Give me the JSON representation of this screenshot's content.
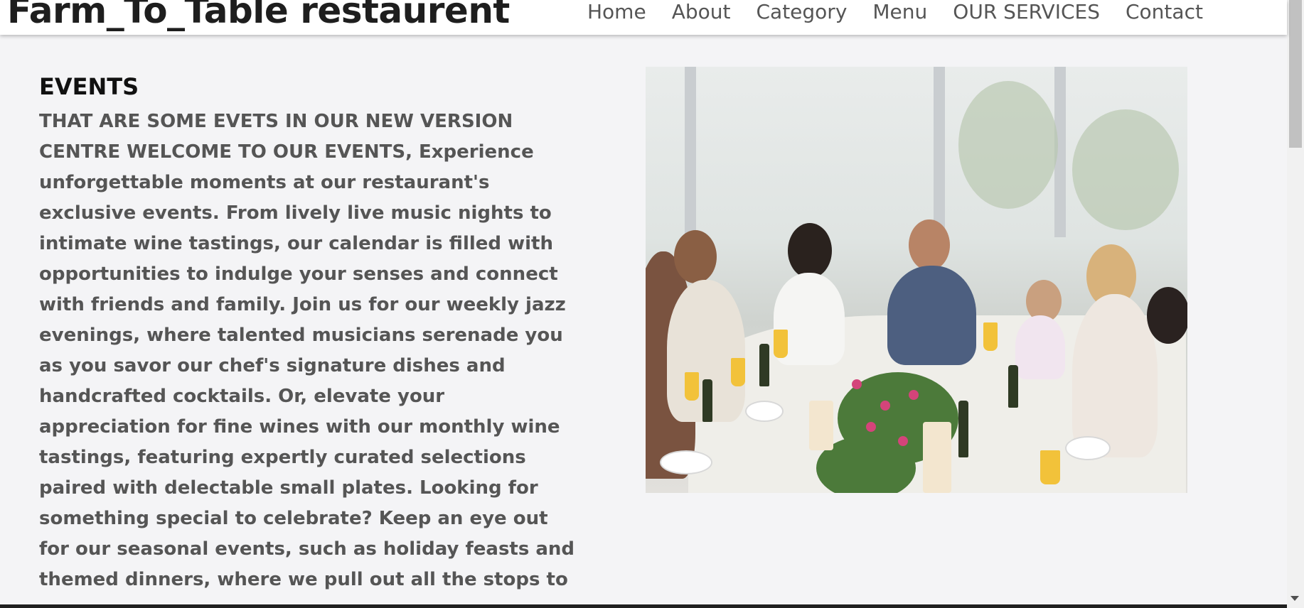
{
  "navbar": {
    "brand": "Farm_To_Table restaurent",
    "links": [
      "Home",
      "About",
      "Category",
      "Menu",
      "OUR SERVICES",
      "Contact"
    ]
  },
  "events": {
    "heading": "EVENTS",
    "text": "THAT ARE SOME EVETS IN OUR NEW VERSION CENTRE WELCOME TO OUR EVENTS, Experience unforgettable moments at our restaurant's exclusive events. From lively live music nights to intimate wine tastings, our calendar is filled with opportunities to indulge your senses and connect with friends and family. Join us for our weekly jazz evenings, where talented musicians serenade you as you savor our chef's signature dishes and handcrafted cocktails. Or, elevate your appreciation for fine wines with our monthly wine tastings, featuring expertly curated selections paired with delectable small plates. Looking for something special to celebrate? Keep an eye out for our seasonal events, such as holiday feasts and themed dinners, where we pull out all the stops to"
  },
  "colors": {
    "background": "#f4f4f6",
    "navbar": "#ffffff",
    "heading": "#111111",
    "body_text": "#555555"
  }
}
